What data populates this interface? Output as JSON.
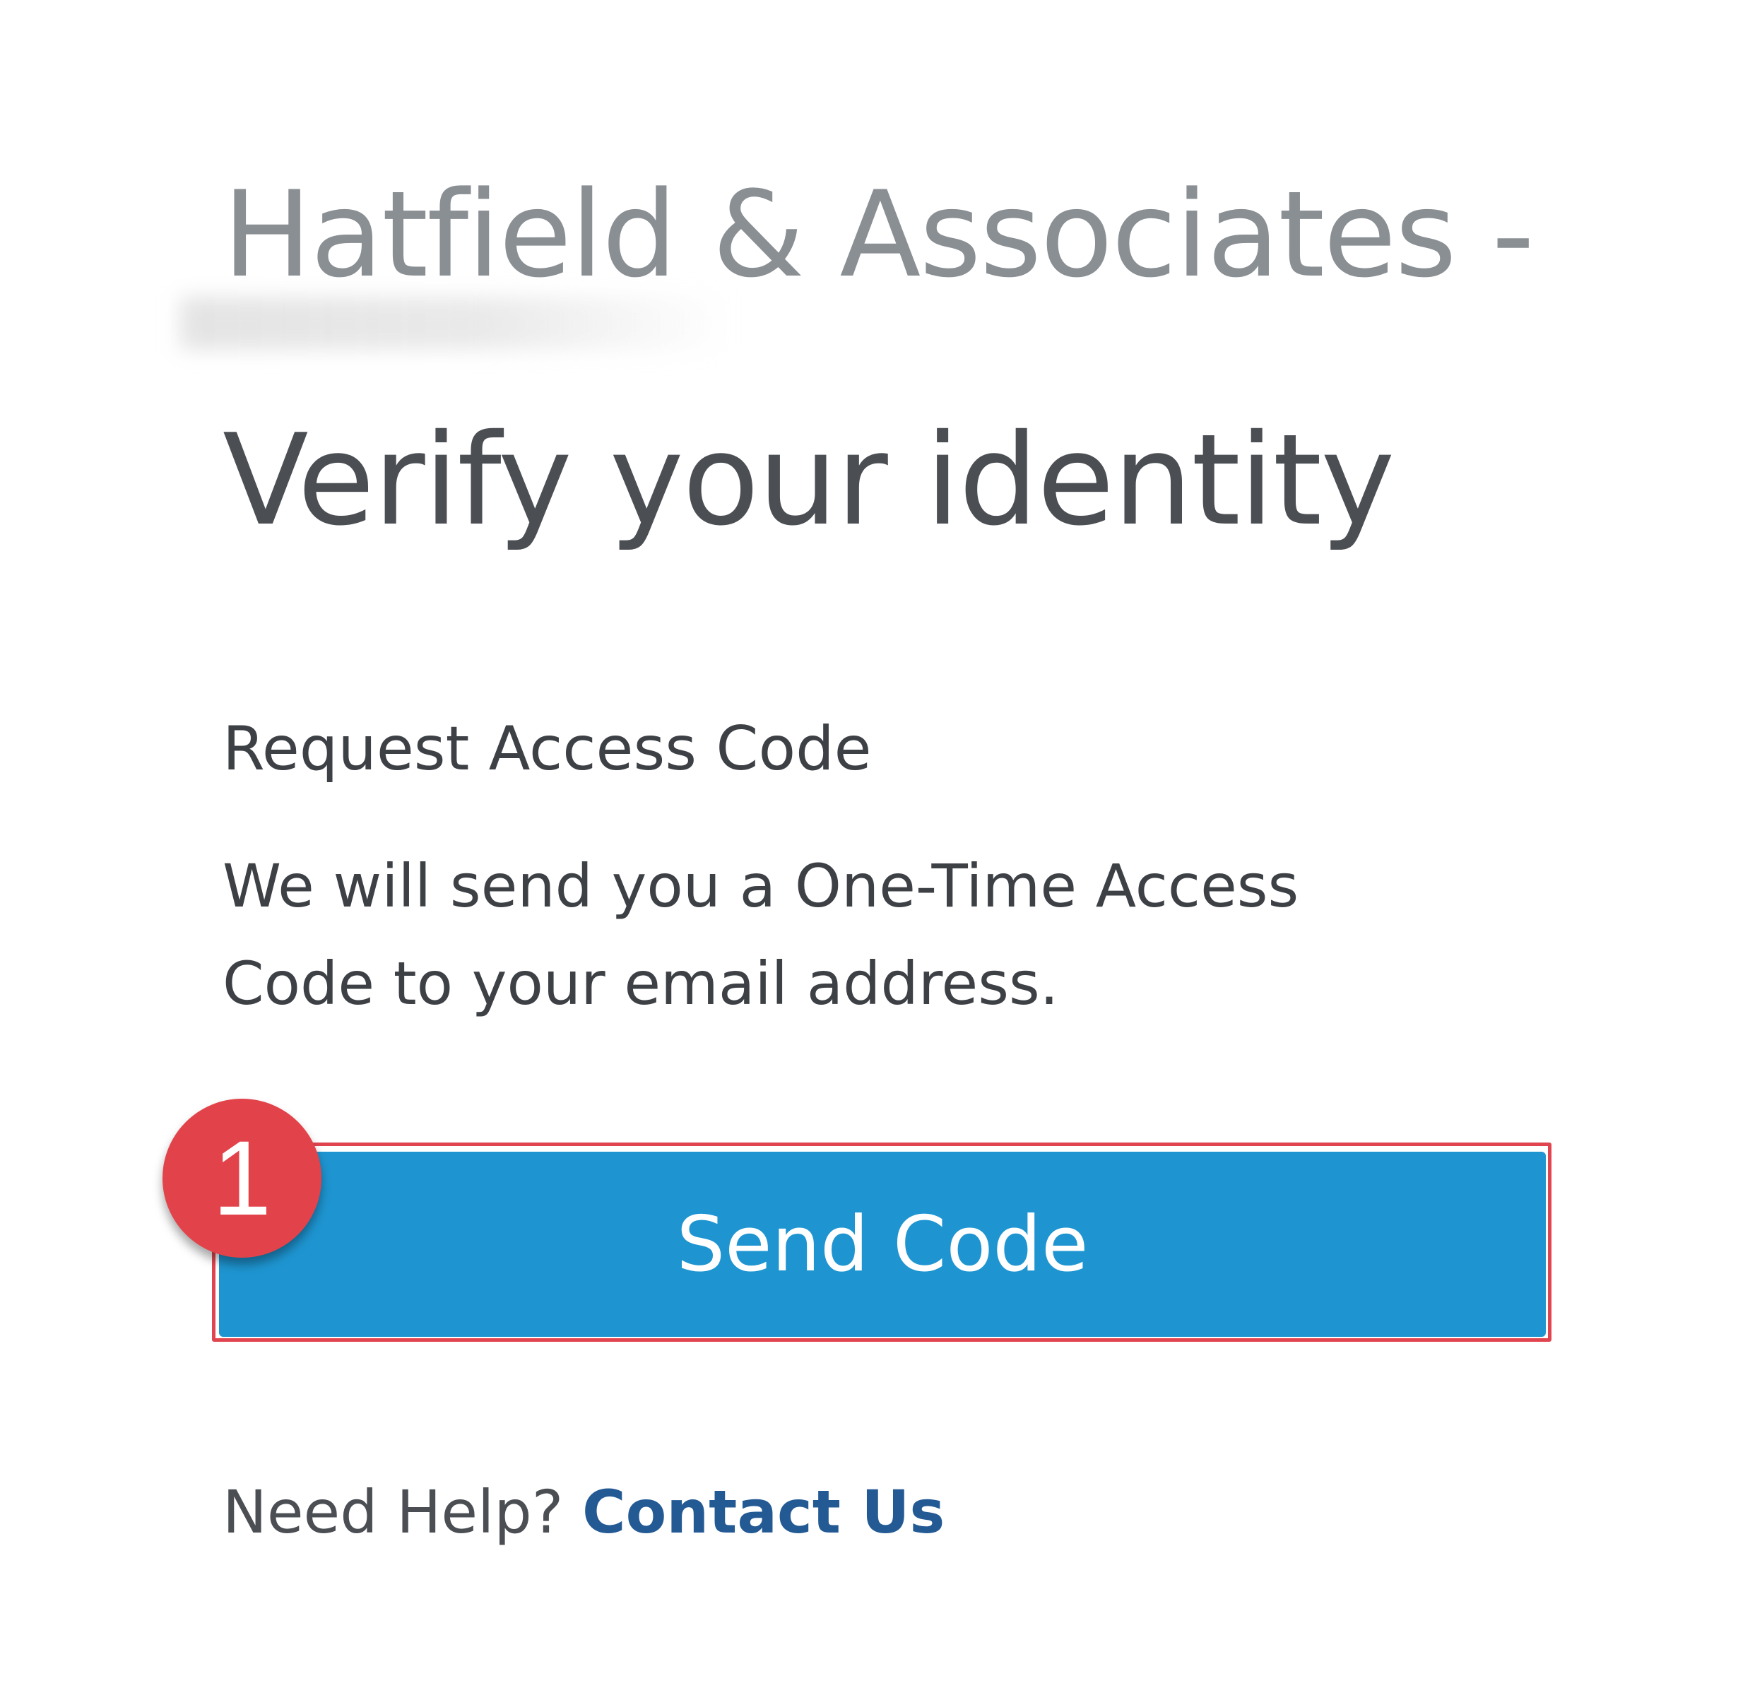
{
  "header": {
    "firm_name": "Hatfield & Associates -"
  },
  "main": {
    "title": "Verify your identity",
    "section_heading": "Request Access Code",
    "description_lines": [
      "We will send you a One-Time Access",
      "Code to your email address."
    ],
    "send_button_label": "Send Code"
  },
  "annotation": {
    "step_number": "1",
    "badge_color": "#e2434b",
    "highlight_color": "#e0454f"
  },
  "footer": {
    "help_text": "Need Help?",
    "contact_link": "Contact Us"
  },
  "colors": {
    "button": "#1e95d1",
    "link": "#245a94"
  }
}
